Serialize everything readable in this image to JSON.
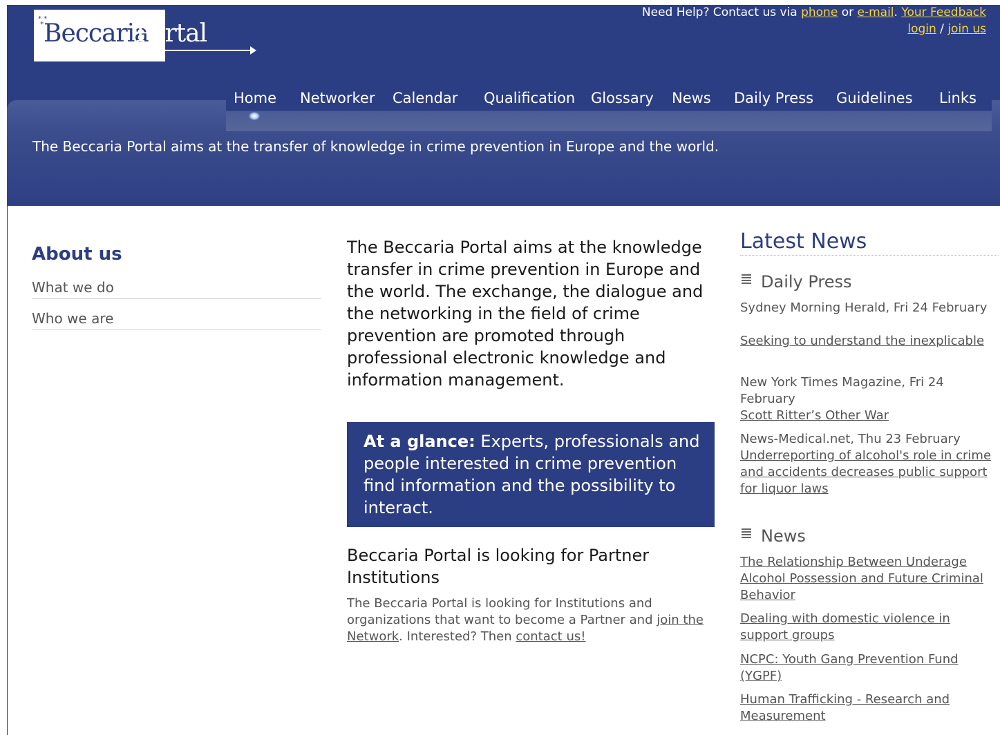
{
  "logo": {
    "word1": "Beccaria",
    "word2": "Portal",
    "stars": "* *\n*"
  },
  "top_bar": {
    "help_prefix": "Need Help? Contact us via ",
    "phone": "phone",
    "or": " or ",
    "email": "e-mail",
    "sep": ". ",
    "feedback": "Your Feedback",
    "login": "login",
    "slash": " / ",
    "join": "join us"
  },
  "nav": [
    {
      "label": "Home"
    },
    {
      "label": "Networker"
    },
    {
      "label": "Calendar"
    },
    {
      "label": "Qualification"
    },
    {
      "label": "Glossary"
    },
    {
      "label": "News"
    },
    {
      "label": "Daily Press"
    },
    {
      "label": "Guidelines"
    },
    {
      "label": "Links"
    }
  ],
  "tagline": "The Beccaria Portal aims at the transfer of knowledge in crime prevention in Europe and the world.",
  "sidebar": {
    "title": "About us",
    "items": [
      {
        "label": "What we do"
      },
      {
        "label": "Who we are"
      }
    ]
  },
  "main": {
    "intro": "The Beccaria Portal aims at the knowledge transfer in crime prevention in Europe and the world. The exchange, the dialogue and the networking in the field of crime prevention are promoted through professional electronic knowledge and information management.",
    "glance_label": "At a glance:",
    "glance_text": " Experts, professionals and people interested in crime prevention find information and the possibility to interact.",
    "partner_title": "Beccaria Portal is looking for Partner Institutions",
    "partner_text1": "The Beccaria Portal is looking for Institutions and organizations that want to become a Partner and ",
    "partner_link1": "join the Network",
    "partner_text2": ". Interested? Then ",
    "partner_link2": "contact us!"
  },
  "news_panel": {
    "title": "Latest News",
    "daily_press_heading": "Daily Press",
    "daily_press": [
      {
        "source": "Sydney Morning Herald, Fri 24 February",
        "headline": "Seeking to understand the inexplicable"
      },
      {
        "source": "New York Times Magazine, Fri 24 February",
        "headline": "Scott Ritter’s Other War"
      },
      {
        "source": "News-Medical.net, Thu 23 February",
        "headline": "Underreporting of alcohol's role in crime and accidents decreases public support for liquor laws"
      }
    ],
    "news_heading": "News",
    "news": [
      {
        "headline": "The Relationship Between Underage Alcohol Possession and Future Criminal Behavior"
      },
      {
        "headline": "Dealing with domestic violence in support groups"
      },
      {
        "headline": "NCPC: Youth Gang Prevention Fund (YGPF)"
      },
      {
        "headline": "Human Trafficking - Research and Measurement"
      }
    ]
  },
  "colors": {
    "brand": "#2c3e83",
    "link_yellow": "#f5d33b",
    "text_grey": "#555555"
  },
  "icons": {
    "section_icon": "newspaper-icon"
  }
}
